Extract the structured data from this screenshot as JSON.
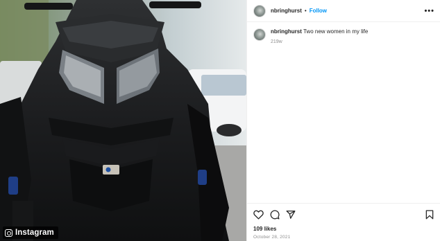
{
  "watermark": {
    "label": "Instagram"
  },
  "post": {
    "username": "nbringhurst",
    "follow_label": "Follow",
    "separator": "•",
    "more_label": "•••",
    "caption": "Two new women in my life",
    "time_ago": "219w",
    "likes": "109 likes",
    "date": "October 28, 2021"
  },
  "icons": {
    "like": "heart-icon",
    "comment": "comment-icon",
    "share": "share-icon",
    "save": "bookmark-icon"
  },
  "colors": {
    "accent": "#0095f6",
    "text": "#262626",
    "muted": "#8e8e8e"
  }
}
